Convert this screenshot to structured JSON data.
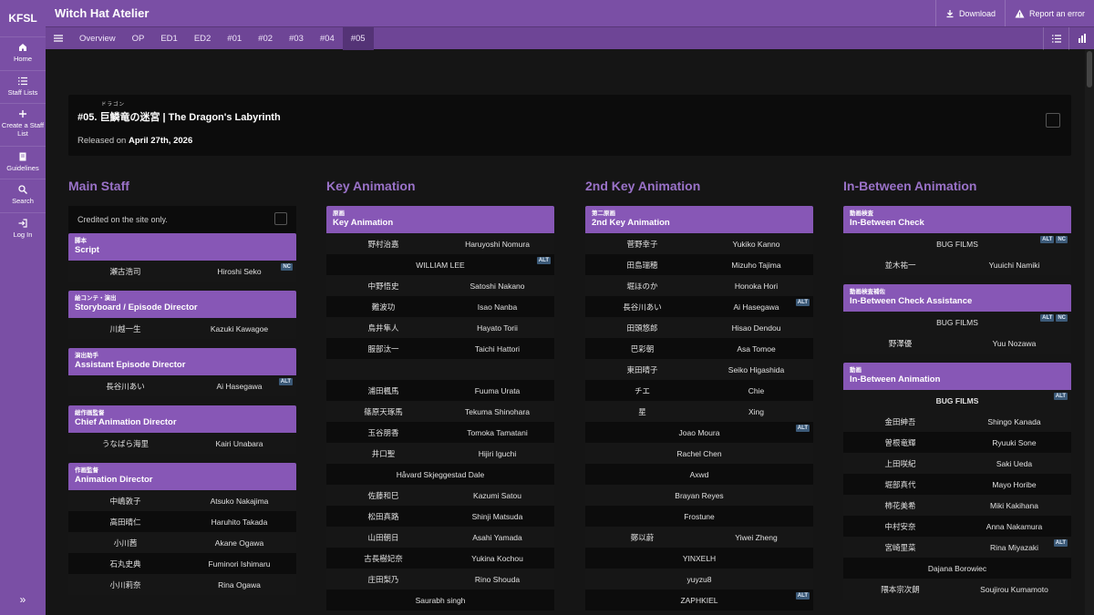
{
  "brand": "KFSL",
  "sidebar": {
    "items": [
      {
        "label": "Home",
        "icon": "home-icon"
      },
      {
        "label": "Staff Lists",
        "icon": "list-icon"
      },
      {
        "label": "Create a Staff List",
        "icon": "plus-icon"
      },
      {
        "label": "Guidelines",
        "icon": "book-icon"
      },
      {
        "label": "Search",
        "icon": "search-icon"
      },
      {
        "label": "Log In",
        "icon": "login-icon"
      }
    ],
    "expand": "»"
  },
  "header": {
    "title": "Witch Hat Atelier",
    "download": "Download",
    "report": "Report an error"
  },
  "tabs": [
    "Overview",
    "OP",
    "ED1",
    "ED2",
    "#01",
    "#02",
    "#03",
    "#04",
    "#05"
  ],
  "active_tab": "#05",
  "episode": {
    "ruby": "ドラゴン",
    "title": "#05. 巨鱗竜の迷宮 | The Dragon's Labyrinth",
    "released_prefix": "Released on",
    "released_date": "April 27th, 2026"
  },
  "columns": {
    "main": {
      "title": "Main Staff",
      "credited": "Credited on the site only.",
      "sections": [
        {
          "jp": "脚本",
          "en": "Script",
          "rows": [
            [
              "瀬古浩司",
              "Hiroshi Seko",
              "NC"
            ]
          ]
        },
        {
          "jp": "絵コンテ・演出",
          "en": "Storyboard / Episode Director",
          "rows": [
            [
              "川越一生",
              "Kazuki Kawagoe",
              ""
            ]
          ]
        },
        {
          "jp": "演出助手",
          "en": "Assistant Episode Director",
          "rows": [
            [
              "長谷川あい",
              "Ai Hasegawa",
              "ALT"
            ]
          ]
        },
        {
          "jp": "総作画監督",
          "en": "Chief Animation Director",
          "rows": [
            [
              "うなばら海里",
              "Kairi Unabara",
              ""
            ]
          ]
        },
        {
          "jp": "作画監督",
          "en": "Animation Director",
          "rows": [
            [
              "中嶋敦子",
              "Atsuko Nakajima",
              ""
            ],
            [
              "高田晴仁",
              "Haruhito Takada",
              ""
            ],
            [
              "小川茜",
              "Akane Ogawa",
              ""
            ],
            [
              "石丸史典",
              "Fuminori Ishimaru",
              ""
            ],
            [
              "小川莉奈",
              "Rina Ogawa",
              ""
            ]
          ]
        }
      ]
    },
    "key": {
      "title": "Key Animation",
      "jp": "原画",
      "en": "Key Animation",
      "rows": [
        [
          "野村治嘉",
          "Haruyoshi Nomura",
          ""
        ],
        [
          "",
          "WILLIAM LEE",
          "ALT"
        ],
        [
          "中野悟史",
          "Satoshi Nakano",
          ""
        ],
        [
          "難波功",
          "Isao Nanba",
          ""
        ],
        [
          "鳥井隼人",
          "Hayato Torii",
          ""
        ],
        [
          "服部汰一",
          "Taichi Hattori",
          ""
        ],
        [
          "",
          "",
          ""
        ],
        [
          "浦田楓馬",
          "Fuuma Urata",
          ""
        ],
        [
          "篠原天琢馬",
          "Tekuma Shinohara",
          ""
        ],
        [
          "玉谷朋香",
          "Tomoka Tamatani",
          ""
        ],
        [
          "井口聖",
          "Hijiri Iguchi",
          ""
        ],
        [
          "",
          "Håvard Skjeggestad Dale",
          ""
        ],
        [
          "佐藤和巳",
          "Kazumi Satou",
          ""
        ],
        [
          "松田真路",
          "Shinji Matsuda",
          ""
        ],
        [
          "山田朝日",
          "Asahi Yamada",
          ""
        ],
        [
          "古長樹妃奈",
          "Yukina Kochou",
          ""
        ],
        [
          "庄田梨乃",
          "Rino Shouda",
          ""
        ],
        [
          "",
          "Saurabh singh",
          ""
        ]
      ]
    },
    "second": {
      "title": "2nd Key Animation",
      "jp": "第二原画",
      "en": "2nd Key Animation",
      "rows": [
        [
          "菅野幸子",
          "Yukiko Kanno",
          ""
        ],
        [
          "田島瑞穂",
          "Mizuho Tajima",
          ""
        ],
        [
          "堀ほのか",
          "Honoka Hori",
          ""
        ],
        [
          "長谷川あい",
          "Ai Hasegawa",
          "ALT"
        ],
        [
          "田頭悠郎",
          "Hisao Dendou",
          ""
        ],
        [
          "巴彩朝",
          "Asa Tomoe",
          ""
        ],
        [
          "東田晴子",
          "Seiko Higashida",
          ""
        ],
        [
          "チエ",
          "Chie",
          ""
        ],
        [
          "星",
          "Xing",
          ""
        ],
        [
          "",
          "Joao Moura",
          "ALT"
        ],
        [
          "",
          "Rachel Chen",
          ""
        ],
        [
          "",
          "Axwd",
          ""
        ],
        [
          "",
          "Brayan Reyes",
          ""
        ],
        [
          "",
          "Frostune",
          ""
        ],
        [
          "鄭以蔚",
          "Yiwei Zheng",
          ""
        ],
        [
          "",
          "YINXELH",
          ""
        ],
        [
          "",
          "yuyzu8",
          ""
        ],
        [
          "",
          "ZAPHKIEL",
          "ALT"
        ]
      ]
    },
    "between": {
      "title": "In-Between Animation",
      "sections": [
        {
          "jp": "動画検査",
          "en": "In-Between Check",
          "studio": "BUG FILMS",
          "studio_badges": [
            "ALT",
            "NC"
          ],
          "rows": [
            [
              "並木祐一",
              "Yuuichi Namiki",
              ""
            ]
          ]
        },
        {
          "jp": "動画検査補佐",
          "en": "In-Between Check Assistance",
          "studio": "BUG FILMS",
          "studio_badges": [
            "ALT",
            "NC"
          ],
          "rows": [
            [
              "野澤優",
              "Yuu Nozawa",
              ""
            ]
          ]
        },
        {
          "jp": "動画",
          "en": "In-Between Animation",
          "studio": "BUG FILMS",
          "studio_badges": [
            "ALT"
          ],
          "rows": [
            [
              "金田紳吾",
              "Shingo Kanada",
              ""
            ],
            [
              "曽根竜輝",
              "Ryuuki Sone",
              ""
            ],
            [
              "上田咲紀",
              "Saki Ueda",
              ""
            ],
            [
              "堀部真代",
              "Mayo Horibe",
              ""
            ],
            [
              "柿花美希",
              "Miki Kakihana",
              ""
            ],
            [
              "中村安奈",
              "Anna Nakamura",
              ""
            ],
            [
              "宮崎里菜",
              "Rina Miyazaki",
              "ALT"
            ],
            [
              "",
              "Dajana Borowiec",
              ""
            ],
            [
              "隈本宗次朗",
              "Soujirou Kumamoto",
              ""
            ]
          ]
        }
      ]
    }
  }
}
